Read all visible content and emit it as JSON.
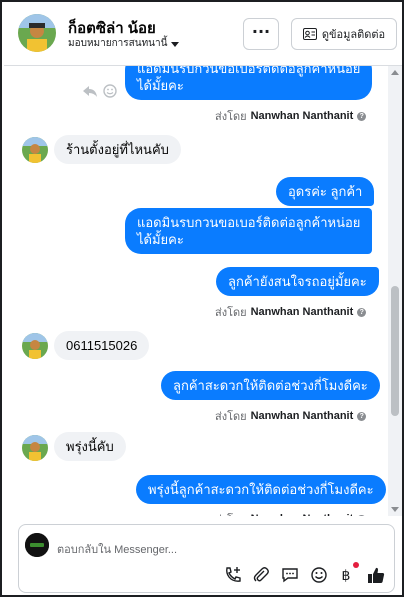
{
  "header": {
    "contact_name": "ก็อตซิล่า น้อย",
    "assign_label": "มอบหมายการสนทนานี้",
    "more_label": "···",
    "contact_info_label": "ดูข้อมูลติดต่อ"
  },
  "messages": {
    "partial_top_lines": [
      "แอดมินรบกวนขอเบอร์ติดต่อลูกค้าหน่อย",
      "ได้มั้ยคะ"
    ],
    "sender_prefix": "ส่งโดย",
    "sender_name": "Nanwhan Nanthanit",
    "incoming_1": "ร้านตั้งอยู่ที่ไหนคับ",
    "outgoing_1": "อุดรค่ะ ลูกค้า",
    "outgoing_2_line1": "แอดมินรบกวนขอเบอร์ติดต่อลูกค้าหน่อย",
    "outgoing_2_line2": "ได้มั้ยคะ",
    "outgoing_3": "ลูกค้ายังสนใจรถอยู่มั้ยคะ",
    "incoming_2": "0611515026",
    "outgoing_4": "ลูกค้าสะดวกให้ติดต่อช่วงกี่โมงดีคะ",
    "incoming_3": "พรุ่งนี้คับ",
    "outgoing_5": "พรุ่งนี้ลูกค้าสะดวกให้ติดต่อช่วงกี่โมงดีคะ"
  },
  "composer": {
    "placeholder": "ตอบกลับใน Messenger..."
  },
  "icons": {
    "reply": "reply-icon",
    "emoji": "smile-icon",
    "call": "add-call-icon",
    "attach": "paperclip-icon",
    "saved_reply": "chat-bubble-icon",
    "sticker": "emoji-icon",
    "baht": "baht-icon",
    "like": "thumbs-up-icon"
  },
  "colors": {
    "outgoing_bubble": "#0a7cff",
    "incoming_bubble": "#f0f2f5",
    "notification_dot": "#e41e3f"
  }
}
